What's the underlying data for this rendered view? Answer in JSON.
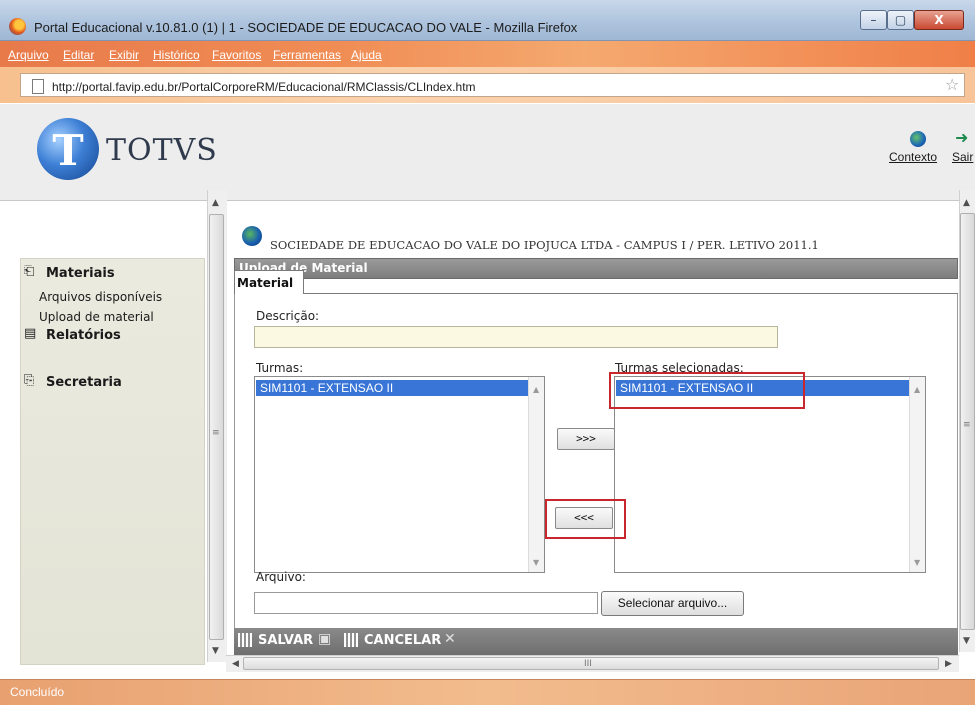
{
  "window": {
    "title": "Portal Educacional v.10.81.0 (1) | 1 - SOCIEDADE DE EDUCACAO DO VALE - Mozilla Firefox",
    "minimize_glyph": "–",
    "maximize_glyph": "▢",
    "close_glyph": "X"
  },
  "menu": {
    "items": [
      "Arquivo",
      "Editar",
      "Exibir",
      "Histórico",
      "Favoritos",
      "Ferramentas",
      "Ajuda"
    ]
  },
  "address_bar": {
    "url": "http://portal.favip.edu.br/PortalCorporeRM/Educacional/RMClassis/CLIndex.htm",
    "star_glyph": "☆"
  },
  "header": {
    "logo_letter": "T",
    "logo_text": "TOTVS",
    "contexto_label": "Contexto",
    "sair_label": "Sair",
    "exit_glyph": "➜"
  },
  "sidebar": {
    "sections": [
      {
        "label": "Materiais",
        "icon": "briefcase-icon",
        "glyph": "⎗",
        "items": [
          "Arquivos disponíveis",
          "Upload de material"
        ]
      },
      {
        "label": "Relatórios",
        "icon": "report-icon",
        "glyph": "▤"
      },
      {
        "label": "Secretaria",
        "icon": "clipboard-icon",
        "glyph": "⎘"
      }
    ]
  },
  "content": {
    "org_title": "SOCIEDADE DE EDUCACAO DO VALE DO IPOJUCA LTDA - CAMPUS I / PER. LETIVO 2011.1",
    "page_title": "Upload de Material",
    "tab_label": "Material",
    "descricao_label": "Descrição:",
    "descricao_value": "",
    "turmas_label": "Turmas:",
    "turmas_items": [
      "SIM1101 - EXTENSAO II"
    ],
    "turmas_selecionadas_label": "Turmas selecionadas:",
    "turmas_selecionadas_items": [
      "SIM1101 - EXTENSAO II"
    ],
    "add_button": ">>>",
    "remove_button": "<<<",
    "arquivo_label": "Arquivo:",
    "arquivo_value": "",
    "select_file_button": "Selecionar arquivo...",
    "salvar_label": "SALVAR",
    "cancelar_label": "CANCELAR",
    "save_glyph": "▣",
    "cancel_glyph": "✕"
  },
  "scrollbars": {
    "up": "▲",
    "down": "▼",
    "left": "◀",
    "right": "▶",
    "grip": "≡",
    "grip_h": "III"
  },
  "status": {
    "text": "Concluído"
  },
  "colors": {
    "selection": "#3875d7",
    "highlight": "#c8272e",
    "menu_bar": "#f08d55"
  }
}
